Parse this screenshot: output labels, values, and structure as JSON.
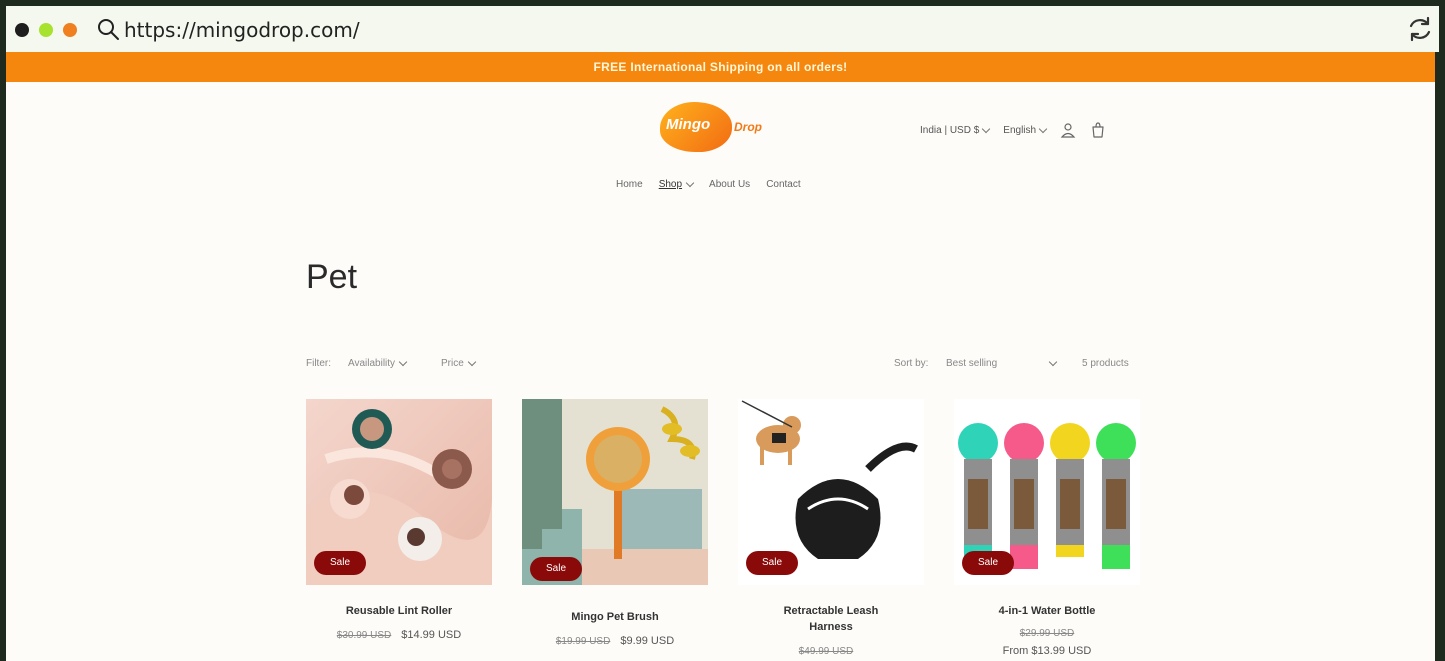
{
  "browser": {
    "url": "https://mingodrop.com/"
  },
  "announcement": "FREE International Shipping on all orders!",
  "logo": {
    "part1": "Mingo",
    "part2": "Drop"
  },
  "header": {
    "currency": "India | USD $",
    "language": "English"
  },
  "nav": {
    "items": [
      "Home",
      "Shop",
      "About Us",
      "Contact"
    ]
  },
  "page_title": "Pet",
  "filters": {
    "filter_label": "Filter:",
    "availability": "Availability",
    "price": "Price",
    "sort_label": "Sort by:",
    "sort_value": "Best selling",
    "product_count": "5 products"
  },
  "products": [
    {
      "badge": "Sale",
      "name": "Reusable Lint Roller",
      "old_price": "$30.99 USD",
      "price": "$14.99 USD"
    },
    {
      "badge": "Sale",
      "name": "Mingo Pet Brush",
      "old_price": "$19.99 USD",
      "price": "$9.99 USD"
    },
    {
      "badge": "Sale",
      "name": "Retractable Leash Harness",
      "old_price": "$49.99 USD",
      "price": ""
    },
    {
      "badge": "Sale",
      "name": "4-in-1 Water Bottle",
      "old_price": "$29.99 USD",
      "price": "From $13.99 USD"
    }
  ],
  "colors": {
    "announcement_bg": "#f5870f",
    "sale_badge": "#8a0a0a",
    "brand": "#f27a16"
  }
}
